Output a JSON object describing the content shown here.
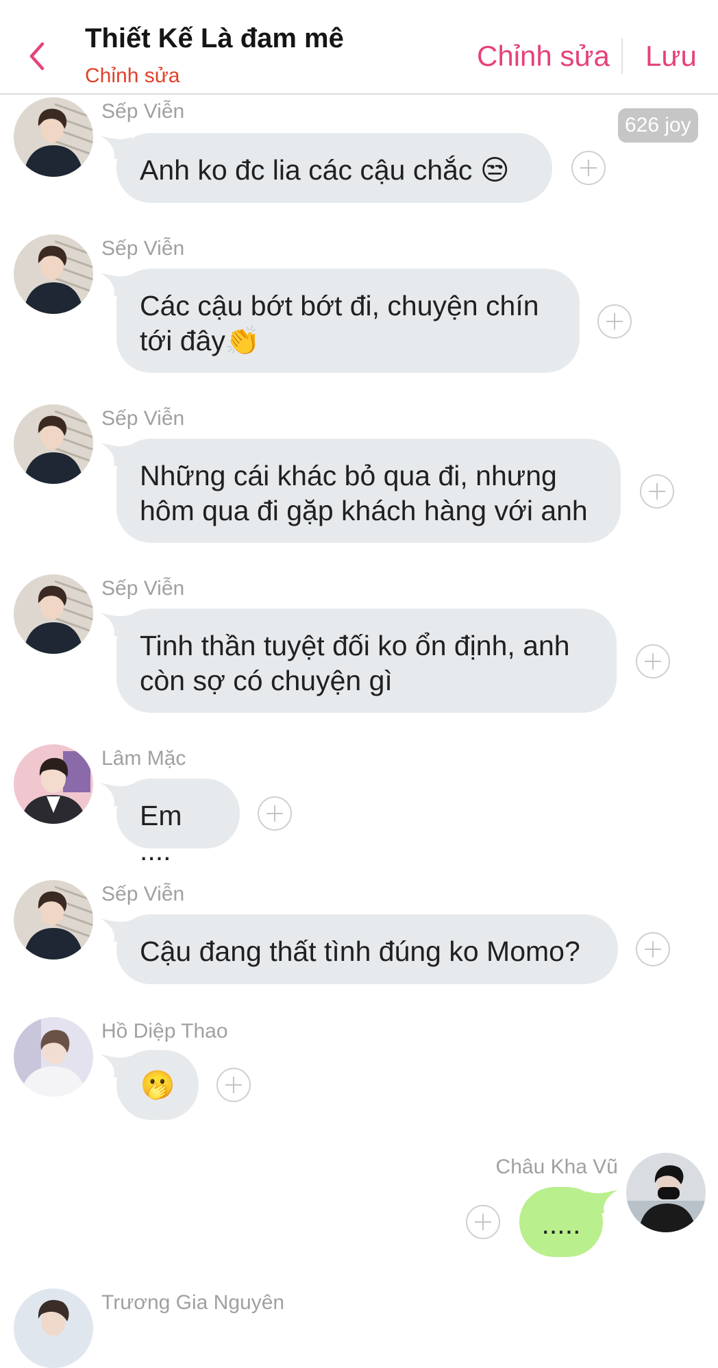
{
  "header": {
    "title": "Thiết Kế Là đam mê",
    "subtitle": "Chỉnh sửa",
    "edit_label": "Chỉnh sửa",
    "save_label": "Lưu",
    "back_icon": "chevron-left-icon"
  },
  "joy_badge": "626 joy",
  "colors": {
    "accent": "#e6427a",
    "subtitle": "#e0422a",
    "bubble_gray": "#e7eaec",
    "bubble_green": "#b9ef8c"
  },
  "messages": [
    {
      "sender": "Sếp Viễn",
      "text": "Anh ko đc lia các cậu chắc 😒"
    },
    {
      "sender": "Sếp Viễn",
      "lines": [
        "Các cậu bớt bớt đi, chuyện chín",
        "tới đây👏"
      ]
    },
    {
      "sender": "Sếp Viễn",
      "lines": [
        "Những cái khác bỏ qua đi, nhưng",
        "hôm qua đi gặp khách hàng với anh"
      ]
    },
    {
      "sender": "Sếp Viễn",
      "lines": [
        "Tinh thần tuyệt đối ko ổn định, anh",
        "còn sợ có chuyện gì"
      ]
    },
    {
      "sender": "Lâm Mặc",
      "text": "Em ...."
    },
    {
      "sender": "Sếp Viễn",
      "text": "Cậu đang thất tình đúng ko Momo?"
    },
    {
      "sender": "Hồ Diệp Thao",
      "text": "🫢"
    },
    {
      "sender": "Châu Kha Vũ",
      "text": "....."
    },
    {
      "sender": "Trương Gia Nguyên"
    }
  ]
}
